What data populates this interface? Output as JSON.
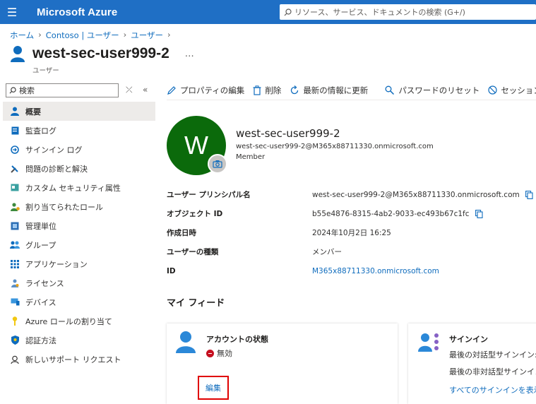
{
  "header": {
    "brand": "Microsoft Azure",
    "search_placeholder": "リソース、サービス、ドキュメントの検索 (G+/)"
  },
  "breadcrumb": [
    "ホーム",
    "Contoso | ユーザー",
    "ユーザー"
  ],
  "page": {
    "title": "west-sec-user999-2",
    "subtitle": "ユーザー",
    "more": "…"
  },
  "sidebar": {
    "search_label": "検索",
    "items": [
      {
        "label": "概要",
        "icon": "user-icon"
      },
      {
        "label": "監査ログ",
        "icon": "log-icon"
      },
      {
        "label": "サインイン ログ",
        "icon": "signin-icon"
      },
      {
        "label": "問題の診断と解決",
        "icon": "wrench-icon"
      },
      {
        "label": "カスタム セキュリティ属性",
        "icon": "attribute-icon"
      },
      {
        "label": "割り当てられたロール",
        "icon": "roles-icon"
      },
      {
        "label": "管理単位",
        "icon": "admin-unit-icon"
      },
      {
        "label": "グループ",
        "icon": "group-icon"
      },
      {
        "label": "アプリケーション",
        "icon": "apps-icon"
      },
      {
        "label": "ライセンス",
        "icon": "license-icon"
      },
      {
        "label": "デバイス",
        "icon": "device-icon"
      },
      {
        "label": "Azure ロールの割り当て",
        "icon": "key-icon"
      },
      {
        "label": "認証方法",
        "icon": "shield-icon"
      },
      {
        "label": "新しいサポート リクエスト",
        "icon": "support-icon"
      }
    ]
  },
  "toolbar": {
    "edit_props": "プロパティの編集",
    "delete": "削除",
    "refresh": "最新の情報に更新",
    "reset_password": "パスワードのリセット",
    "revoke_sessions": "セッション"
  },
  "profile": {
    "initial": "W",
    "name": "west-sec-user999-2",
    "upn": "west-sec-user999-2@M365x88711330.onmicrosoft.com",
    "type": "Member"
  },
  "properties": [
    {
      "key": "ユーザー プリンシパル名",
      "value": "west-sec-user999-2@M365x88711330.onmicrosoft.com"
    },
    {
      "key": "オブジェクト ID",
      "value": "b55e4876-8315-4ab2-9033-ec493b67c1fc"
    },
    {
      "key": "作成日時",
      "value": "2024年10月2日 16:25"
    },
    {
      "key": "ユーザーの種類",
      "value": "メンバー"
    },
    {
      "key": "ID",
      "value": "M365x88711330.onmicrosoft.com"
    }
  ],
  "feed": {
    "title": "マイ フィード",
    "account": {
      "title": "アカウントの状態",
      "status": "無効",
      "edit": "編集"
    },
    "signin": {
      "title": "サインイン",
      "line1": "最後の対話型サインイン:",
      "line2": "最後の非対話型サインイン",
      "link": "すべてのサインインを表示"
    }
  },
  "colors": {
    "brand_bar": "#1f6fc5",
    "avatar": "#0b6a0b",
    "link": "#0f6cbd",
    "highlight_box": "#e00000"
  }
}
